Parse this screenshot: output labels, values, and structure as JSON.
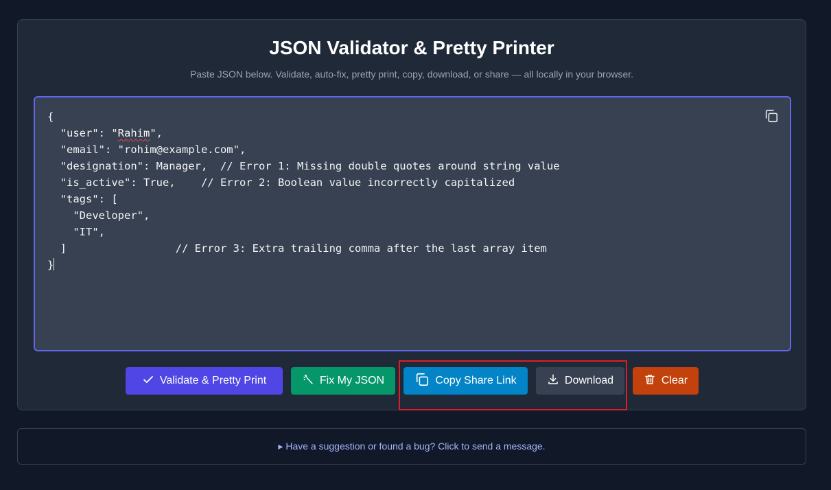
{
  "header": {
    "title": "JSON Validator & Pretty Printer",
    "subtitle": "Paste JSON below. Validate, auto-fix, pretty print, copy, download, or share — all locally in your browser."
  },
  "editor": {
    "lines": [
      "{",
      "  \"user\": \"",
      "Rahim",
      "\",",
      "  \"email\": \"rohim@example.com\",",
      "  \"designation\": Manager,  // Error 1: Missing double quotes around string value",
      "  \"is_active\": True,    // Error 2: Boolean value incorrectly capitalized",
      "  \"tags\": [",
      "    \"Developer\",",
      "    \"IT\",",
      "  ]                 // Error 3: Extra trailing comma after the last array item",
      "}"
    ]
  },
  "actions": {
    "validate_label": "Validate & Pretty Print",
    "fix_label": "Fix My JSON",
    "share_label": "Copy Share Link",
    "download_label": "Download",
    "clear_label": "Clear"
  },
  "footer": {
    "feedback_text": "▸ Have a suggestion or found a bug? Click to send a message."
  },
  "colors": {
    "validate": "#4f46e5",
    "fix": "#059669",
    "share": "#0284c7",
    "download": "#374151",
    "clear": "#c2410c",
    "editor_border": "#6366f1",
    "highlight": "#e11d24"
  },
  "icons": {
    "validate": "check-icon",
    "fix": "wand-icon",
    "share": "copy-icon",
    "download": "download-icon",
    "clear": "trash-icon",
    "editor": "copy-icon"
  }
}
